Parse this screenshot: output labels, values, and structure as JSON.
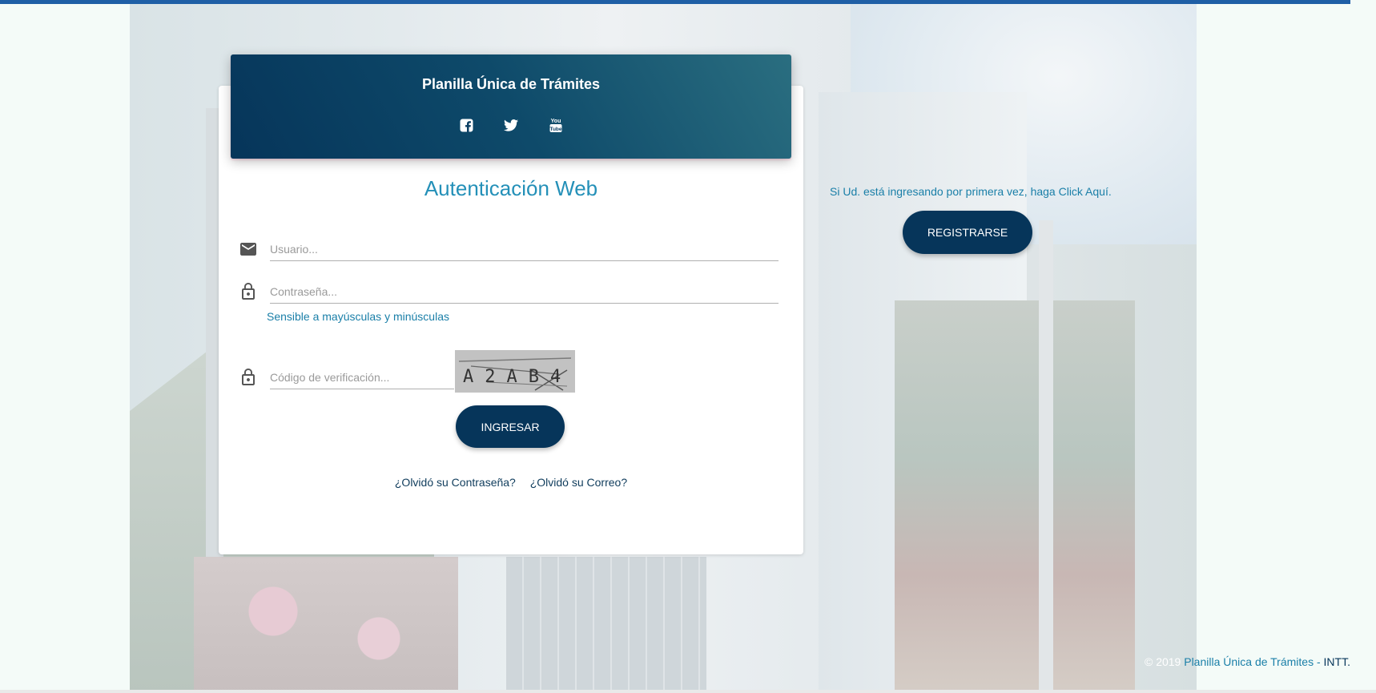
{
  "header": {
    "title": "Planilla Única de Trámites",
    "socials": [
      {
        "icon": "facebook-icon"
      },
      {
        "icon": "twitter-icon"
      },
      {
        "icon": "youtube-icon"
      }
    ]
  },
  "login": {
    "title": "Autenticación Web",
    "username_placeholder": "Usuario...",
    "password_placeholder": "Contraseña...",
    "case_hint": "Sensible a mayúsculas y minúsculas",
    "captcha_placeholder": "Código de verificación...",
    "captcha_text": "A2AB4",
    "submit_label": "INGRESAR",
    "forgot_password": "¿Olvidó su Contraseña?",
    "forgot_email": "¿Olvidó su Correo?"
  },
  "register": {
    "prompt": "Si Ud. está ingresando por primera vez, haga Click Aquí.",
    "button_label": "REGISTRARSE"
  },
  "footer": {
    "copyright": "© 2019",
    "app_name": "Planilla Única de Trámites",
    "separator": " - ",
    "org": "INTT."
  },
  "colors": {
    "primary": "#06355a",
    "accent": "#2490b8",
    "topbar": "#1f5fa6"
  }
}
